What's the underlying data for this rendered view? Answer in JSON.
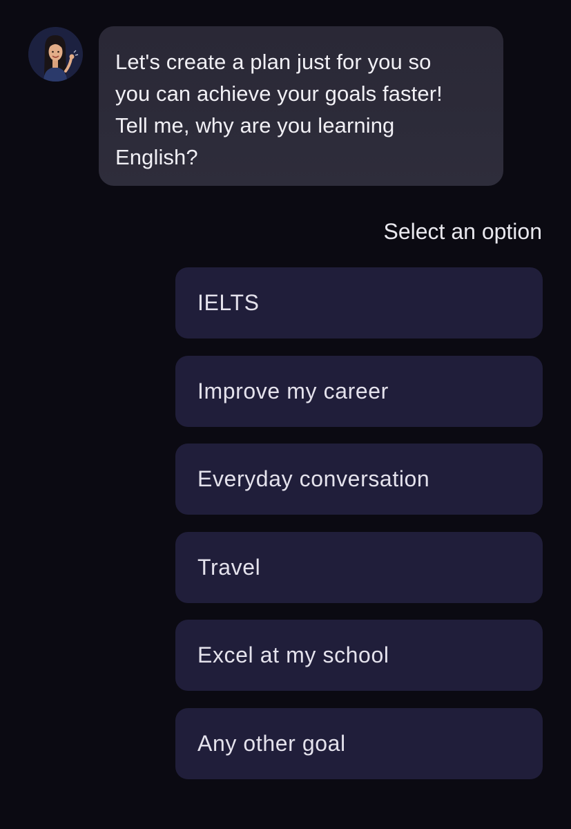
{
  "chat": {
    "avatar_icon": "waving-avatar-icon",
    "message_lines": [
      "Let's create a plan just for you so",
      "you can achieve your goals faster!",
      "Tell me, why are you learning",
      "English?"
    ]
  },
  "prompt": {
    "label": "Select an option"
  },
  "options": [
    {
      "label": "IELTS"
    },
    {
      "label": "Improve my career"
    },
    {
      "label": "Everyday conversation"
    },
    {
      "label": "Travel"
    },
    {
      "label": "Excel at my school"
    },
    {
      "label": "Any other goal"
    }
  ],
  "colors": {
    "background": "#0b0a12",
    "bubble": "#2c2b39",
    "option": "#201e3a",
    "text": "#e6e4ee"
  }
}
